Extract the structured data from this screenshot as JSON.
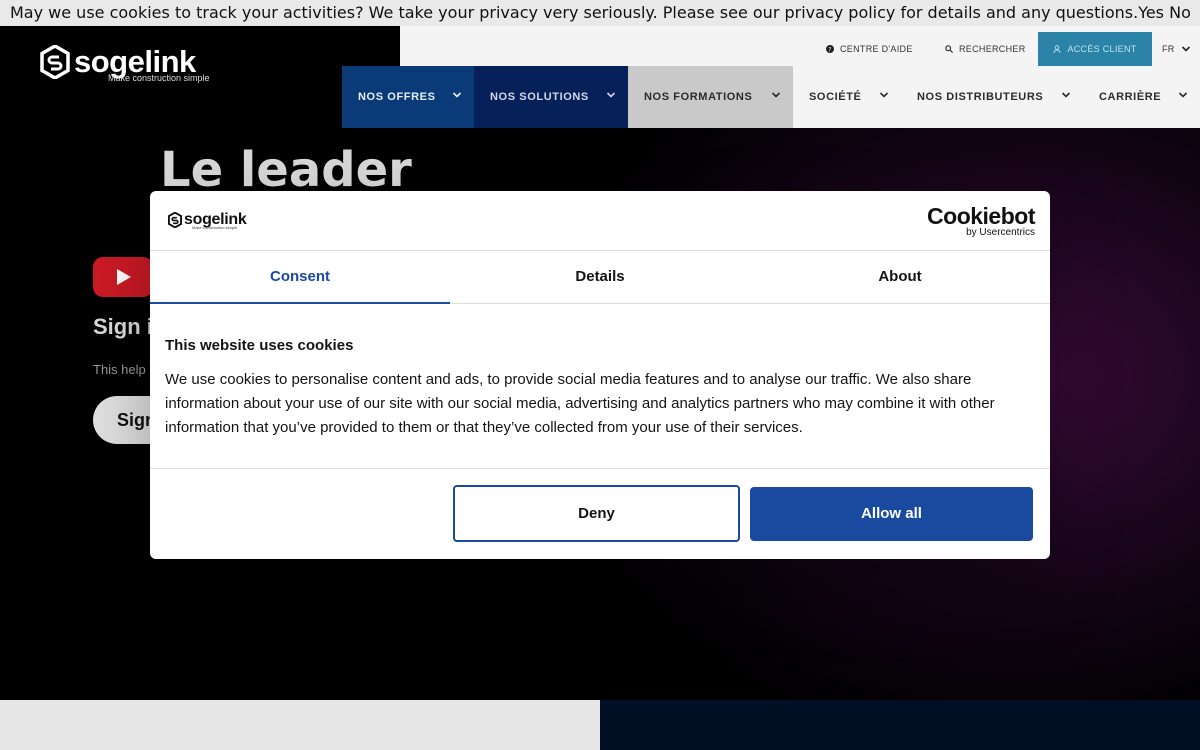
{
  "topbar": {
    "message": "May we use cookies to track your activities? We take your privacy very seriously. Please see our privacy policy for details and any questions.",
    "yes": "Yes",
    "no": "No"
  },
  "brand": {
    "name": "sogelink",
    "tagline": "Make construction simple"
  },
  "utility": {
    "help": "CENTRE D'AIDE",
    "search": "RECHERCHER",
    "client": "ACCÈS CLIENT",
    "lang": "FR"
  },
  "nav": {
    "offres": "NOS OFFRES",
    "solutions": "NOS SOLUTIONS",
    "formations": "NOS FORMATIONS",
    "societe": "SOCIÉTÉ",
    "distributeurs": "NOS DISTRIBUTEURS",
    "carriere": "CARRIÈRE"
  },
  "hero": {
    "title": "Le leader",
    "sign": "Sign i",
    "help": "This help",
    "button": "Sign"
  },
  "modal": {
    "provider": "Cookiebot",
    "provider_by": "by Usercentrics",
    "tabs": [
      "Consent",
      "Details",
      "About"
    ],
    "heading": "This website uses cookies",
    "body": "We use cookies to personalise content and ads, to provide social media features and to analyse our traffic. We also share information about your use of our site with our social media, advertising and analytics partners who may combine it with other information that you’ve provided to them or that they’ve collected from your use of their services.",
    "deny": "Deny",
    "allow": "Allow all"
  },
  "colors": {
    "accent": "#1a4aa0",
    "client_button": "#2b84a8",
    "nav_offres": "#0a3a78",
    "nav_solutions": "#06205a",
    "nav_formations": "#c9c9c9",
    "youtube_red": "#cc1a26"
  }
}
